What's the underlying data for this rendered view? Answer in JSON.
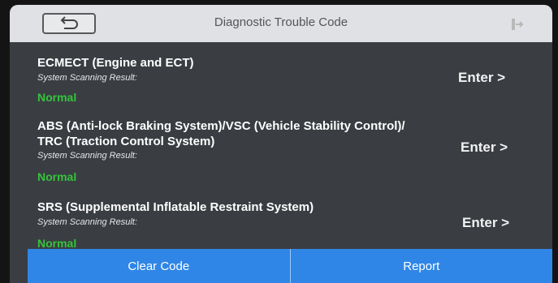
{
  "header": {
    "title": "Diagnostic Trouble Code",
    "back_icon": "back-arrow-icon",
    "exit_icon": "exit-icon"
  },
  "systems": [
    {
      "name_line1": "ECMECT (Engine and ECT)",
      "name_line2": "",
      "scan_label": "System Scanning Result:",
      "status": "Normal",
      "enter_label": "Enter >"
    },
    {
      "name_line1": "ABS (Anti-lock Braking System)/VSC (Vehicle Stability Control)/",
      "name_line2": "TRC (Traction Control System)",
      "scan_label": "System Scanning Result:",
      "status": "Normal",
      "enter_label": "Enter >"
    },
    {
      "name_line1": "SRS (Supplemental Inflatable Restraint System)",
      "name_line2": "",
      "scan_label": "System Scanning Result:",
      "status": "Normal",
      "enter_label": "Enter >"
    }
  ],
  "footer": {
    "clear_code_label": "Clear Code",
    "report_label": "Report"
  },
  "colors": {
    "status_normal": "#35c43b",
    "action_bar": "#2f86e6"
  }
}
